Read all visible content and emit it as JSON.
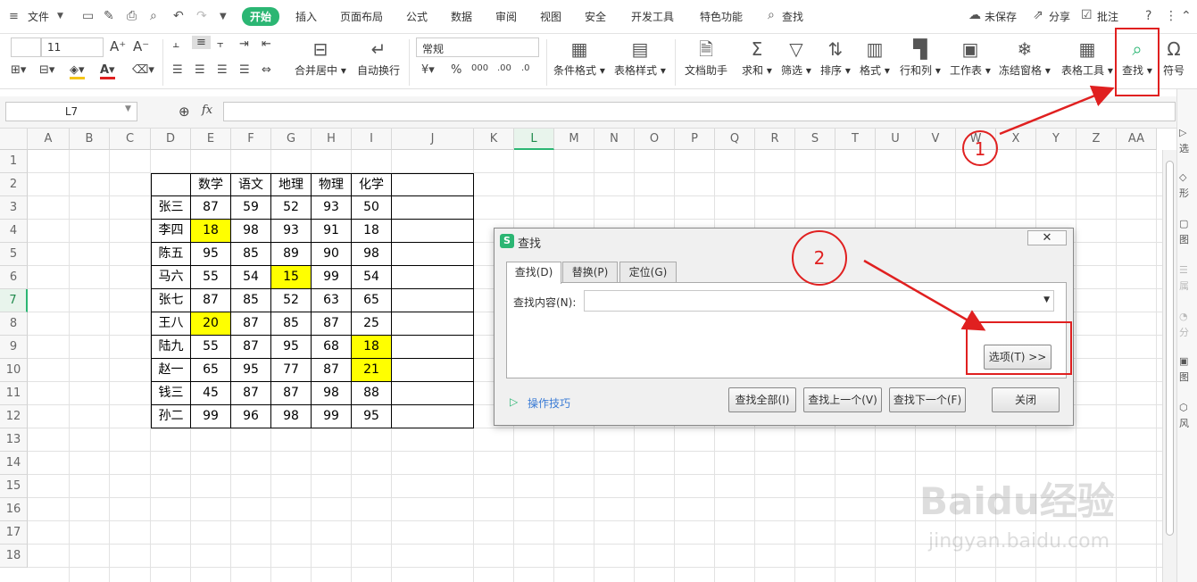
{
  "menubar": {
    "file": "文件",
    "tabs": [
      "开始",
      "插入",
      "页面布局",
      "公式",
      "数据",
      "审阅",
      "视图",
      "安全",
      "开发工具",
      "特色功能"
    ],
    "search": "查找",
    "unsaved": "未保存",
    "share": "分享",
    "comment": "批注"
  },
  "ribbon": {
    "font_size": "11",
    "merge_center": "合并居中",
    "auto_wrap": "自动换行",
    "number_format": "常规",
    "cond_format": "条件格式",
    "table_style": "表格样式",
    "doc_helper": "文档助手",
    "sum": "求和",
    "filter": "筛选",
    "sort": "排序",
    "format": "格式",
    "row_col": "行和列",
    "worksheet": "工作表",
    "freeze": "冻结窗格",
    "table_tools": "表格工具",
    "find": "查找",
    "symbol": "符号"
  },
  "formula_bar": {
    "cell_ref": "L7",
    "fx": "fx"
  },
  "columns": [
    "A",
    "B",
    "C",
    "D",
    "E",
    "F",
    "G",
    "H",
    "I",
    "J",
    "K",
    "L",
    "M",
    "N",
    "O",
    "P",
    "Q",
    "R",
    "S",
    "T",
    "U",
    "V",
    "W",
    "X",
    "Y",
    "Z",
    "AA"
  ],
  "rows": [
    "1",
    "2",
    "3",
    "4",
    "5",
    "6",
    "7",
    "8",
    "9",
    "10",
    "11",
    "12",
    "13",
    "14",
    "15",
    "16",
    "17",
    "18"
  ],
  "selected": {
    "col": "L",
    "row": "7"
  },
  "table": {
    "headers": [
      "",
      "数学",
      "语文",
      "地理",
      "物理",
      "化学",
      ""
    ],
    "data": [
      [
        "张三",
        "87",
        "59",
        "52",
        "93",
        "50",
        ""
      ],
      [
        "李四",
        "18",
        "98",
        "93",
        "91",
        "18",
        ""
      ],
      [
        "陈五",
        "95",
        "85",
        "89",
        "90",
        "98",
        ""
      ],
      [
        "马六",
        "55",
        "54",
        "15",
        "99",
        "54",
        ""
      ],
      [
        "张七",
        "87",
        "85",
        "52",
        "63",
        "65",
        ""
      ],
      [
        "王八",
        "20",
        "87",
        "85",
        "87",
        "25",
        ""
      ],
      [
        "陆九",
        "55",
        "87",
        "95",
        "68",
        "18",
        ""
      ],
      [
        "赵一",
        "65",
        "95",
        "77",
        "87",
        "21",
        ""
      ],
      [
        "钱三",
        "45",
        "87",
        "87",
        "98",
        "88",
        ""
      ],
      [
        "孙二",
        "99",
        "96",
        "98",
        "99",
        "95",
        ""
      ]
    ],
    "highlight_color": "#ffff00"
  },
  "dialog": {
    "title": "查找",
    "tabs": [
      "查找(D)",
      "替换(P)",
      "定位(G)"
    ],
    "find_label": "查找内容(N):",
    "options": "选项(T) >>",
    "tips": "操作技巧",
    "find_all": "查找全部(I)",
    "find_prev": "查找上一个(V)",
    "find_next": "查找下一个(F)",
    "close": "关闭"
  },
  "annotations": {
    "step1": "1",
    "step2": "2",
    "color": "#e02020"
  },
  "right_pane": [
    "选",
    "形",
    "图",
    "属",
    "分",
    "图",
    "风"
  ],
  "watermark": {
    "logo": "Baidu经验",
    "url": "jingyan.baidu.com"
  },
  "colors": {
    "accent": "#2bb673"
  }
}
